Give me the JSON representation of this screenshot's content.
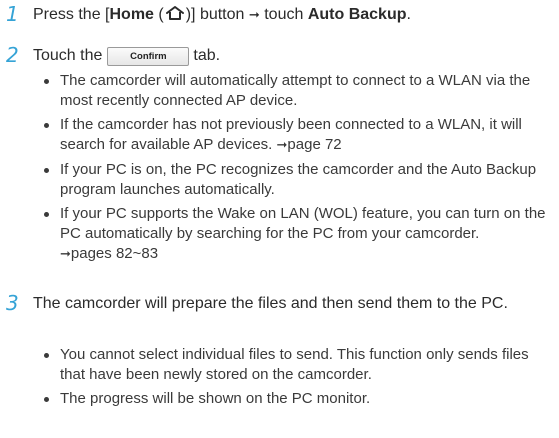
{
  "step1": {
    "number": "1",
    "prefix": "Press the [",
    "home_label": "Home",
    "home_open": " (",
    "home_close": ")] button ",
    "arrow": "➞",
    "touch": " touch ",
    "target": "Auto Backup",
    "end": "."
  },
  "step2": {
    "number": "2",
    "prefix": "Touch the",
    "button_label": "Confirm",
    "suffix": "tab.",
    "bullets": [
      {
        "text": "The camcorder will automatically attempt to connect to a WLAN via the most recently connected AP device."
      },
      {
        "text": "If the camcorder has not previously been connected to a WLAN, it will search for available AP devices. ",
        "ref": "page 72"
      },
      {
        "text": "If your PC is on, the PC recognizes the camcorder and the Auto Backup program launches automatically."
      },
      {
        "text": "If your PC supports the Wake on LAN (WOL) feature, you can turn on the PC automatically by searching for the PC from your camcorder. ",
        "ref": "pages 82~83"
      }
    ]
  },
  "step3": {
    "number": "3",
    "text": "The camcorder will prepare the files and then send them to the PC.",
    "bullets": [
      {
        "text": "You cannot select individual files to send. This function only sends files that have been newly stored on the camcorder."
      },
      {
        "text": "The progress will be shown on the PC monitor."
      }
    ]
  },
  "colors": {
    "step_number": "#35a3d6",
    "text": "#2b2b2b"
  },
  "icons": {
    "home": "home-icon",
    "ref_arrow": "right-arrow-icon"
  }
}
